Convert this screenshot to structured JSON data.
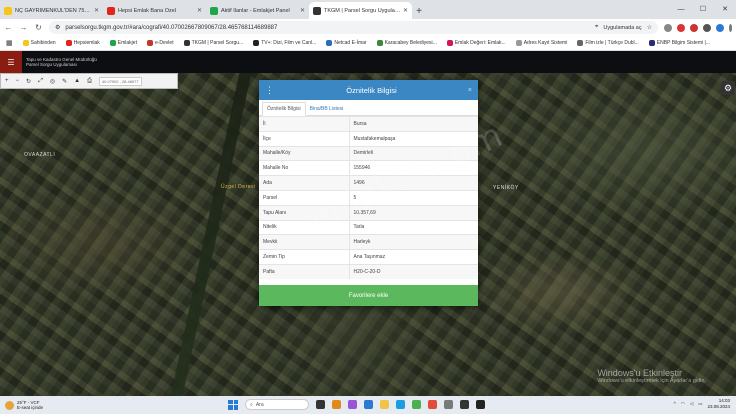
{
  "browser": {
    "tabs": [
      {
        "title": "NÇ GAYRİMENKUL'DEN 7500m2 SA",
        "color": "#f5c518",
        "active": false
      },
      {
        "title": "Hepsi Emlak Bana Özel",
        "color": "#e1251b",
        "active": false
      },
      {
        "title": "Aktif İlanlar - Emlakjet Panel",
        "color": "#1ea64a",
        "active": false
      },
      {
        "title": "TKGM | Parsel Sorgu Uygulaması",
        "color": "#333333",
        "active": true
      }
    ],
    "new_tab": "+",
    "url": "parselsorgu.tkgm.gov.tr/#ara/cografi/40.07002667809067/28.465768114689887",
    "location_label": "Uygulamada aç",
    "bookmarks": [
      "Sahibinden",
      "Hepsiemlak",
      "Emlakjet",
      "e-Devlet",
      "TKGM | Parsel Sorgu...",
      "TV+: Dizi, Film ve Canl...",
      "Netcad E-İmar",
      "Karacabey Belediyesi...",
      "Emlak Değeri: Emlak...",
      "Adres Kayıt Sistemi",
      "Film izle | Türkçe Dubl...",
      "ENBP Bilgim Sistemi |..."
    ]
  },
  "app": {
    "header_line1": "Tapu ve Kadastro Genel Müdürlüğü",
    "header_line2": "Parsel Sorgu Uygulaması",
    "coords": "40.07002 , 28.46577"
  },
  "map_labels": {
    "town_left": "OVAAZATLI",
    "stream": "Üzgel Deresi",
    "town_right": "YENİKÖY"
  },
  "watermark": {
    "line1": "Windows'u Etkinleştir",
    "line2": "Windows'u etkinleştirmek için Ayarlar'a gidin."
  },
  "dialog": {
    "title": "Öznitelik Bilgisi",
    "close": "×",
    "tabs": [
      "Öznitelik Bilgisi",
      "Bina/BB Listesi"
    ],
    "rows": [
      {
        "key": "İl",
        "value": "Bursa"
      },
      {
        "key": "İlçe",
        "value": "Mustafakemalpaşa"
      },
      {
        "key": "Mahalle/Köy",
        "value": "Demirleli"
      },
      {
        "key": "Mahalle No",
        "value": "155946"
      },
      {
        "key": "Ada",
        "value": "1496"
      },
      {
        "key": "Parsel",
        "value": "5"
      },
      {
        "key": "Tapu Alanı",
        "value": "10.357,69"
      },
      {
        "key": "Nitelik",
        "value": "Tarla"
      },
      {
        "key": "Mevkii",
        "value": "Harleyk"
      },
      {
        "key": "Zemin Tip",
        "value": "Ana Taşınmaz"
      },
      {
        "key": "Pafta",
        "value": "H20-C-20-D"
      }
    ],
    "favorite_button": "Favorilere ekle",
    "overlay_watermark": "emlaket.com"
  },
  "taskbar": {
    "weather_temp": "25°F - VCF",
    "weather_desc": "E-seat içinde",
    "search_placeholder": "Ara",
    "time": "14:03",
    "date": "23.08.2024"
  }
}
